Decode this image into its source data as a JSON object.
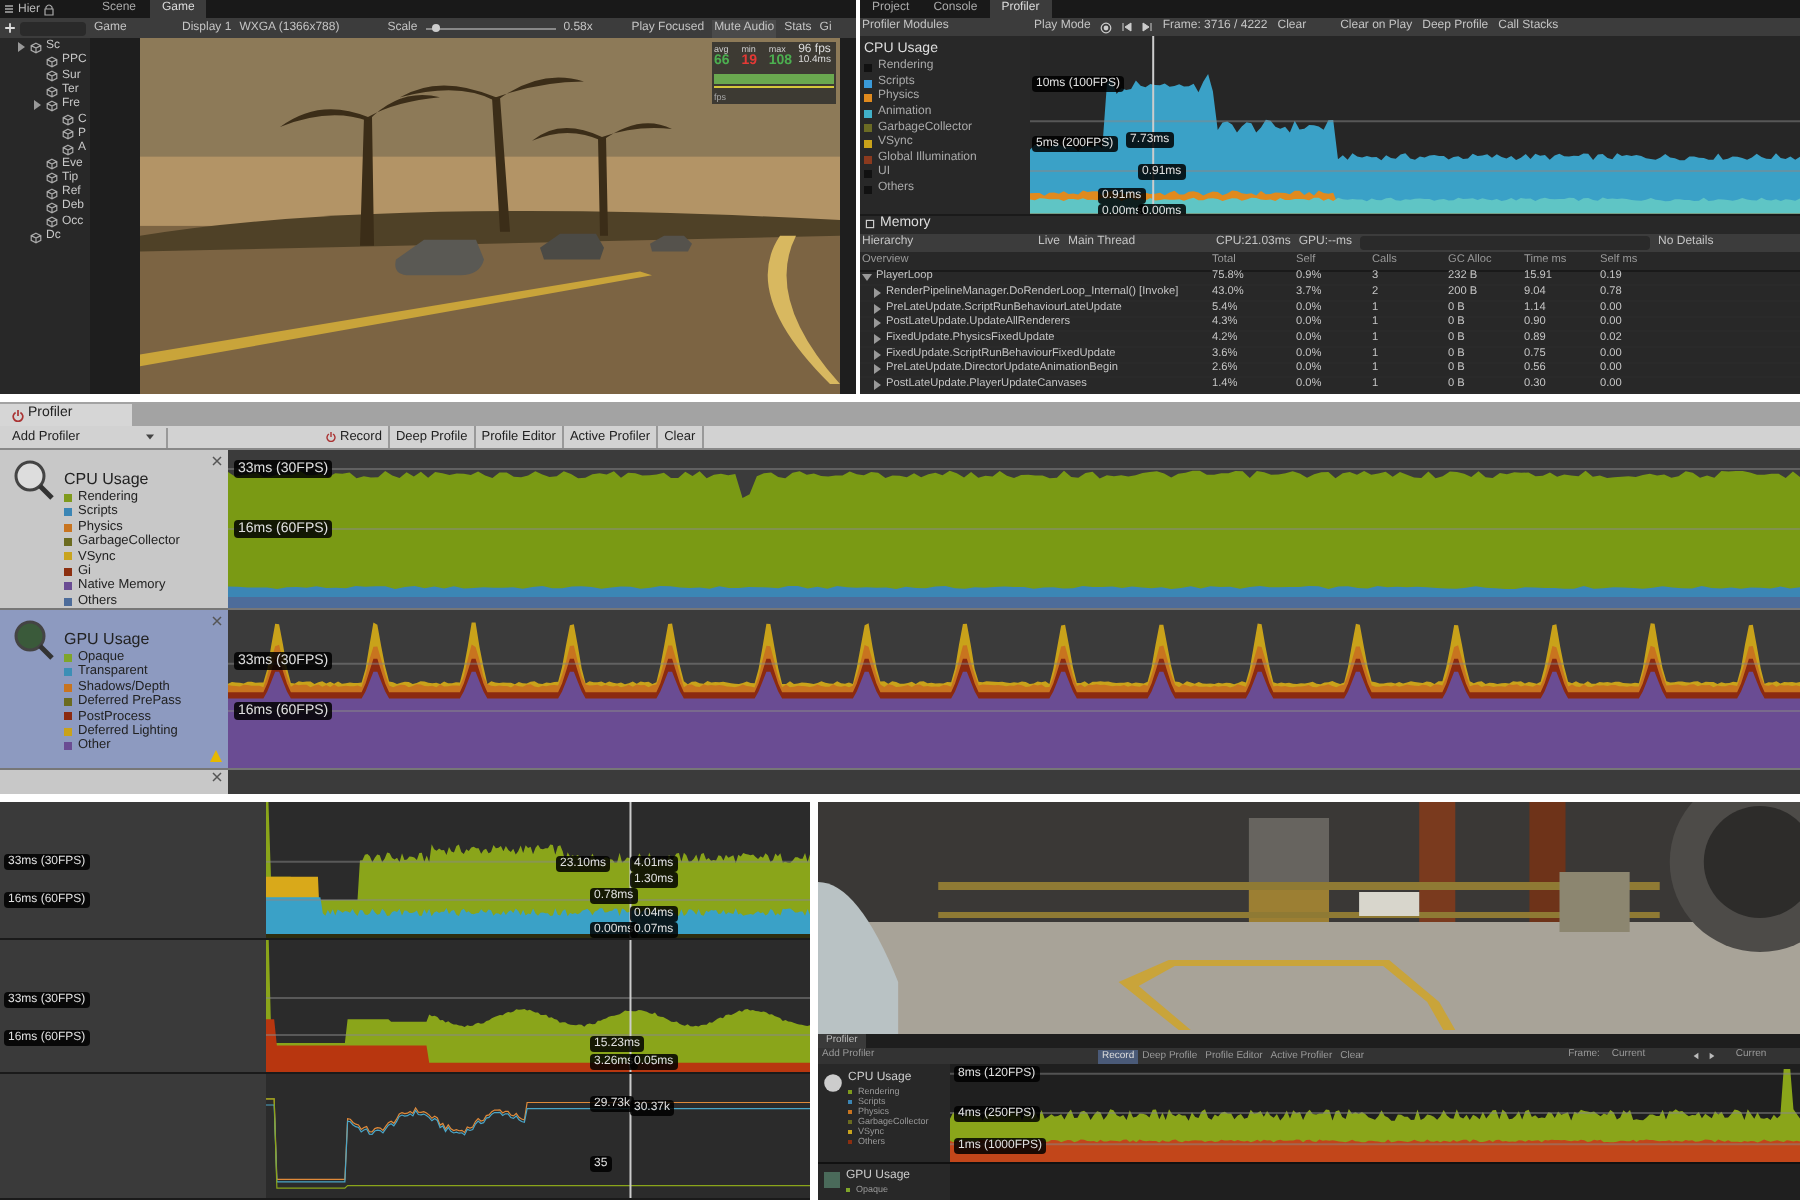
{
  "game_panel": {
    "hierarchy": {
      "tab": "Hier",
      "items": [
        {
          "label": "Sc",
          "children": [
            {
              "label": "PPC"
            },
            {
              "label": "Sur"
            },
            {
              "label": "Ter"
            },
            {
              "label": "Fre",
              "children": [
                {
                  "label": "C"
                },
                {
                  "label": "P"
                },
                {
                  "label": "A"
                }
              ]
            },
            {
              "label": "Eve"
            },
            {
              "label": "Tip"
            },
            {
              "label": "Ref"
            },
            {
              "label": "Deb"
            },
            {
              "label": "Occ"
            }
          ]
        },
        {
          "label": "Dc"
        }
      ]
    },
    "tabs": [
      {
        "label": "Scene",
        "selected": false
      },
      {
        "label": "Game",
        "selected": true
      }
    ],
    "toolbar": {
      "view": "Game",
      "display": "Display 1",
      "resolution": "WXGA (1366x788)",
      "scale": {
        "label": "Scale",
        "level": 0.05,
        "reading": "0.58x"
      },
      "buttons": [
        "Play Focused",
        "Mute Audio",
        "Stats",
        "Gi"
      ]
    },
    "fps_overlay": {
      "headers": [
        "avg",
        "min",
        "max"
      ],
      "values": [
        {
          "text": "66",
          "color": "#4caf50"
        },
        {
          "text": "19",
          "color": "#e53935"
        },
        {
          "text": "108",
          "color": "#4caf50"
        }
      ],
      "fps": "96 fps",
      "ms": "10.4ms",
      "footer": "fps"
    }
  },
  "profiler_panel": {
    "tabs": [
      {
        "label": "Project",
        "selected": false
      },
      {
        "label": "Console",
        "selected": false
      },
      {
        "label": "Profiler",
        "selected": true
      }
    ],
    "toolbar": {
      "modules": "Profiler Modules",
      "mode": "Play Mode",
      "frame": "Frame: 3716 / 4222",
      "buttons": [
        "Clear",
        "Clear on Play",
        "Deep Profile",
        "Call Stacks"
      ]
    },
    "cpu": {
      "title": "CPU Usage",
      "legend": [
        {
          "label": "Rendering",
          "color": "#111111"
        },
        {
          "label": "Scripts",
          "color": "#3a9ad9"
        },
        {
          "label": "Physics",
          "color": "#e08a1e"
        },
        {
          "label": "Animation",
          "color": "#41b0c8"
        },
        {
          "label": "GarbageCollector",
          "color": "#6b6b24"
        },
        {
          "label": "VSync",
          "color": "#c9a21a"
        },
        {
          "label": "Global Illumination",
          "color": "#8b3a1e"
        },
        {
          "label": "UI",
          "color": "#111111"
        },
        {
          "label": "Others",
          "color": "#111111"
        }
      ],
      "chart_labels": [
        "10ms (100FPS)",
        "5ms (200FPS)",
        "7.73ms",
        "0.91ms",
        "0.91ms",
        "0.00ms",
        "0.00ms"
      ]
    },
    "memory": "Memory",
    "hierarchy_bar": {
      "view": "Hierarchy",
      "live": "Live",
      "thread": "Main Thread",
      "cpu": "CPU:21.03ms",
      "gpu": "GPU:--ms",
      "details": "No Details"
    },
    "table": {
      "columns": [
        "Overview",
        "Total",
        "Self",
        "Calls",
        "GC Alloc",
        "Time ms",
        "Self ms"
      ],
      "rows": [
        {
          "cells": [
            "PlayerLoop",
            "75.8%",
            "0.9%",
            "3",
            "232 B",
            "15.91",
            "0.19"
          ],
          "expanded": true,
          "children": [
            {
              "cells": [
                "RenderPipelineManager.DoRenderLoop_Internal() [Invoke]",
                "43.0%",
                "3.7%",
                "2",
                "200 B",
                "9.04",
                "0.78"
              ],
              "expanded": false
            },
            {
              "cells": [
                "PreLateUpdate.ScriptRunBehaviourLateUpdate",
                "5.4%",
                "0.0%",
                "1",
                "0 B",
                "1.14",
                "0.00"
              ],
              "expanded": false
            },
            {
              "cells": [
                "PostLateUpdate.UpdateAllRenderers",
                "4.3%",
                "0.0%",
                "1",
                "0 B",
                "0.90",
                "0.00"
              ],
              "expanded": false
            },
            {
              "cells": [
                "FixedUpdate.PhysicsFixedUpdate",
                "4.2%",
                "0.0%",
                "1",
                "0 B",
                "0.89",
                "0.02"
              ],
              "expanded": false
            },
            {
              "cells": [
                "FixedUpdate.ScriptRunBehaviourFixedUpdate",
                "3.6%",
                "0.0%",
                "1",
                "0 B",
                "0.75",
                "0.00"
              ],
              "expanded": false
            },
            {
              "cells": [
                "PreLateUpdate.DirectorUpdateAnimationBegin",
                "2.6%",
                "0.0%",
                "1",
                "0 B",
                "0.56",
                "0.00"
              ],
              "expanded": false
            },
            {
              "cells": [
                "PostLateUpdate.PlayerUpdateCanvases",
                "1.4%",
                "0.0%",
                "1",
                "0 B",
                "0.30",
                "0.00"
              ],
              "expanded": false
            }
          ]
        }
      ]
    }
  },
  "classic_profiler": {
    "tab": "Profiler",
    "add": "Add Profiler",
    "buttons": [
      {
        "label": "Record",
        "selected": false
      },
      {
        "label": "Deep Profile",
        "selected": false
      },
      {
        "label": "Profile Editor",
        "selected": false
      },
      {
        "label": "Active Profiler",
        "selected": false
      },
      {
        "label": "Clear",
        "selected": false
      }
    ],
    "modules": [
      {
        "title": "CPU Usage",
        "selected": false,
        "legend": [
          {
            "label": "Rendering",
            "color": "#7f9a1c"
          },
          {
            "label": "Scripts",
            "color": "#3b86b5"
          },
          {
            "label": "Physics",
            "color": "#c8741f"
          },
          {
            "label": "GarbageCollector",
            "color": "#6b6b1f"
          },
          {
            "label": "VSync",
            "color": "#c9a41e"
          },
          {
            "label": "Gi",
            "color": "#8c2f10"
          },
          {
            "label": "Native Memory",
            "color": "#6a4c93"
          },
          {
            "label": "Others",
            "color": "#4d6c9a"
          }
        ],
        "labels": [
          "33ms (30FPS)",
          "16ms (60FPS)"
        ]
      },
      {
        "title": "GPU Usage",
        "selected": true,
        "legend": [
          {
            "label": "Opaque",
            "color": "#7fa52a"
          },
          {
            "label": "Transparent",
            "color": "#3c8fb6"
          },
          {
            "label": "Shadows/Depth",
            "color": "#c8741f"
          },
          {
            "label": "Deferred PrePass",
            "color": "#6b6b1f"
          },
          {
            "label": "PostProcess",
            "color": "#8c2a10"
          },
          {
            "label": "Deferred Lighting",
            "color": "#c9a21a"
          },
          {
            "label": "Other",
            "color": "#6a4c93"
          }
        ],
        "labels": [
          "33ms (30FPS)",
          "16ms (60FPS)"
        ]
      }
    ]
  },
  "graphs_panel": {
    "rows": [
      {
        "labels": [
          "33ms (30FPS)",
          "16ms (60FPS)"
        ],
        "values": [
          "23.10ms",
          "4.01ms",
          "1.30ms",
          "0.78ms",
          "0.04ms",
          "0.00ms",
          "0.07ms"
        ]
      },
      {
        "labels": [
          "33ms (30FPS)",
          "16ms (60FPS)"
        ],
        "values": [
          "15.23ms",
          "3.26ms",
          "0.05ms"
        ]
      },
      {
        "labels": [],
        "values": [
          "29.73k",
          "30.37k",
          "35"
        ]
      }
    ]
  },
  "scene_profiler": {
    "tab": "Profiler",
    "add": "Add Profiler",
    "buttons": [
      {
        "label": "Record",
        "selected": true
      },
      {
        "label": "Deep Profile",
        "selected": false
      },
      {
        "label": "Profile Editor",
        "selected": false
      },
      {
        "label": "Active Profiler",
        "selected": false
      },
      {
        "label": "Clear",
        "selected": false
      }
    ],
    "frame": "Frame:",
    "current": "Current",
    "current_button": "Curren",
    "cpu": {
      "title": "CPU Usage",
      "legend": [
        {
          "label": "Rendering",
          "color": "#7f9a1c"
        },
        {
          "label": "Scripts",
          "color": "#3b86b5"
        },
        {
          "label": "Physics",
          "color": "#c8741f"
        },
        {
          "label": "GarbageCollector",
          "color": "#6b6b1f"
        },
        {
          "label": "VSync",
          "color": "#c9a41e"
        },
        {
          "label": "Others",
          "color": "#8c2f10"
        }
      ],
      "labels": [
        "8ms (120FPS)",
        "4ms (250FPS)",
        "1ms (1000FPS)"
      ]
    },
    "gpu": {
      "title": "GPU Usage",
      "legend": [
        {
          "label": "Opaque",
          "color": "#7fa52a"
        }
      ]
    }
  }
}
